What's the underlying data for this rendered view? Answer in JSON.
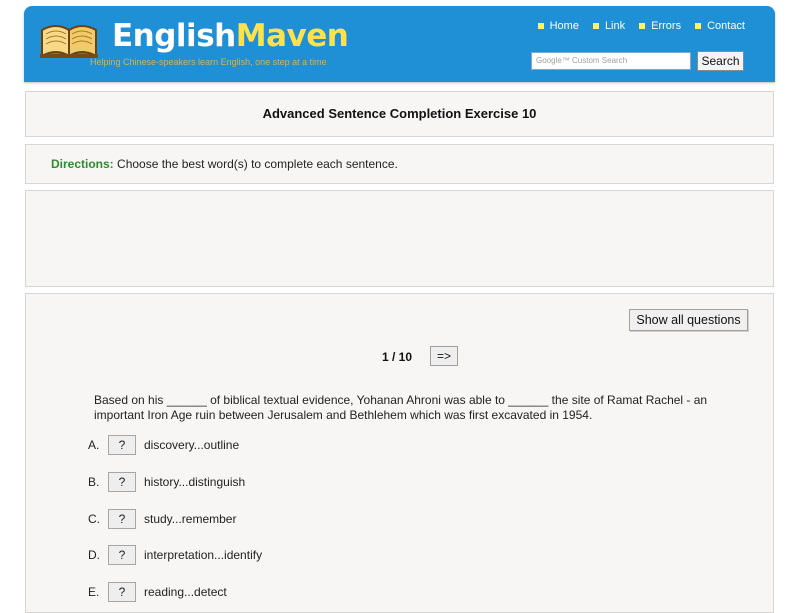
{
  "header": {
    "logo_text_white": "English",
    "logo_text_yellow": "Maven",
    "tagline": "Helping Chinese-speakers learn English, one step at a time",
    "nav": [
      {
        "label": "Home",
        "icon": "square-bullet-icon"
      },
      {
        "label": "Link",
        "icon": "square-bullet-icon"
      },
      {
        "label": "Errors",
        "icon": "square-bullet-icon"
      },
      {
        "label": "Contact",
        "icon": "square-bullet-icon"
      }
    ],
    "search": {
      "placeholder": "Google™ Custom Search",
      "button_label": "Search"
    }
  },
  "title_panel": {
    "title": "Advanced Sentence Completion Exercise 10"
  },
  "directions": {
    "label": "Directions:",
    "text": "Choose the best word(s) to complete each sentence."
  },
  "quiz": {
    "show_all_label": "Show all questions",
    "counter": "1 / 10",
    "next_label": "=>",
    "question": "Based on his ______ of biblical textual evidence, Yohanan Ahroni was able to ______ the site of Ramat Rachel - an important Iron Age ruin between Jerusalem and Bethlehem which was first excavated in 1954.",
    "options": [
      {
        "letter": "A.",
        "button": "?",
        "text": "discovery...outline"
      },
      {
        "letter": "B.",
        "button": "?",
        "text": "history...distinguish"
      },
      {
        "letter": "C.",
        "button": "?",
        "text": "study...remember"
      },
      {
        "letter": "D.",
        "button": "?",
        "text": "interpretation...identify"
      },
      {
        "letter": "E.",
        "button": "?",
        "text": "reading...detect"
      }
    ]
  },
  "colors": {
    "header_blue": "#1f8fd6",
    "logo_yellow": "#ffe24a",
    "directions_green": "#2e8b2e"
  }
}
